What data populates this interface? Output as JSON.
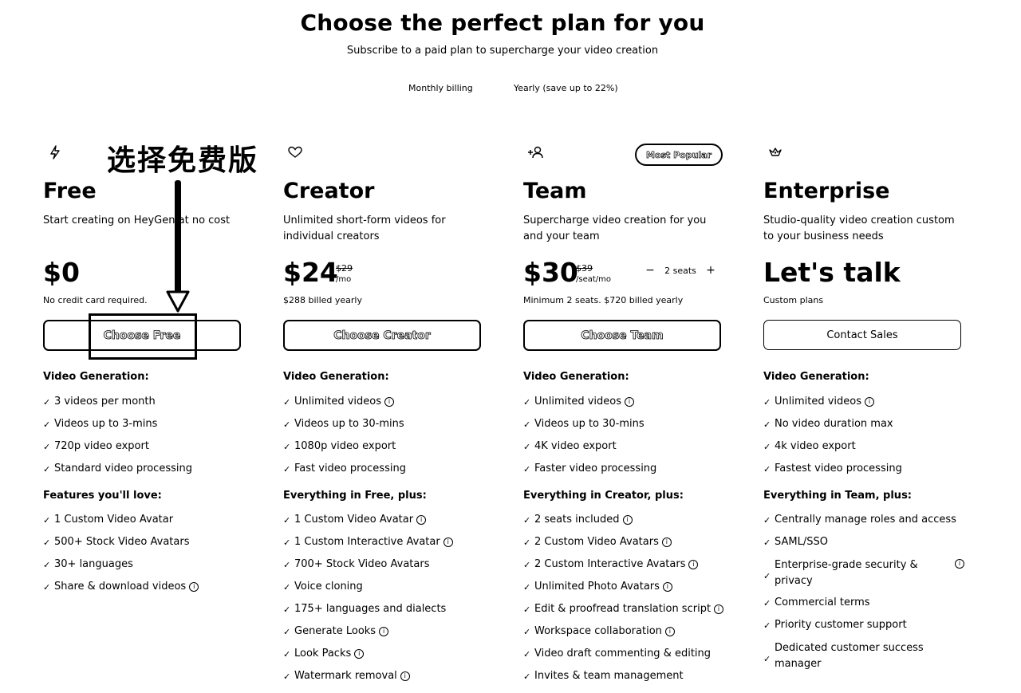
{
  "header": {
    "title": "Choose the perfect plan for you",
    "subtitle": "Subscribe to a paid plan to supercharge your video creation"
  },
  "billing": {
    "monthly": "Monthly billing",
    "yearly": "Yearly (save up to 22%)"
  },
  "annotation": {
    "text": "选择免费版"
  },
  "plans": [
    {
      "icon": "lightning-icon",
      "name": "Free",
      "description": "Start creating on HeyGen at no cost",
      "price": "$0",
      "note": "No credit card required.",
      "cta": "Choose Free",
      "sections": [
        {
          "title": "Video Generation:",
          "items": [
            "3 videos per month",
            "Videos up to 3-mins",
            "720p video export",
            "Standard video processing"
          ]
        },
        {
          "title": "Features you'll love:",
          "items": [
            "1 Custom Video Avatar",
            "500+ Stock Video Avatars",
            "30+ languages",
            "Share & download videos"
          ]
        }
      ]
    },
    {
      "icon": "heart-icon",
      "name": "Creator",
      "description": "Unlimited short-form videos for individual creators",
      "price": "$24",
      "strike": "$29",
      "per": "/mo",
      "note": "$288 billed yearly",
      "cta": "Choose Creator",
      "sections": [
        {
          "title": "Video Generation:",
          "items": [
            "Unlimited videos",
            "Videos up to 30-mins",
            "1080p video export",
            "Fast video processing"
          ]
        },
        {
          "title": "Everything in Free, plus:",
          "items": [
            "1 Custom Video Avatar",
            "1 Custom Interactive Avatar",
            "700+ Stock Video Avatars",
            "Voice cloning",
            "175+ languages and dialects",
            "Generate Looks",
            "Look Packs",
            "Watermark removal"
          ]
        }
      ]
    },
    {
      "icon": "add-user-icon",
      "name": "Team",
      "badge": "Most Popular",
      "description": "Supercharge video creation for you and your team",
      "price": "$30",
      "strike": "$39",
      "per": "/seat/mo",
      "seats": {
        "minus": "−",
        "label": "2 seats",
        "plus": "+"
      },
      "note": "Minimum 2 seats. $720 billed yearly",
      "cta": "Choose Team",
      "sections": [
        {
          "title": "Video Generation:",
          "items": [
            "Unlimited videos",
            "Videos up to 30-mins",
            "4K video export",
            "Faster video processing"
          ]
        },
        {
          "title": "Everything in Creator, plus:",
          "items": [
            "2 seats included",
            "2 Custom Video Avatars",
            "2 Custom Interactive Avatars",
            "Unlimited Photo Avatars",
            "Edit & proofread translation script",
            "Workspace collaboration",
            "Video draft commenting & editing",
            "Invites & team management"
          ]
        }
      ]
    },
    {
      "icon": "crown-icon",
      "name": "Enterprise",
      "description": "Studio-quality video creation custom to your business needs",
      "price": "Let's talk",
      "note": "Custom plans",
      "cta": "Contact Sales",
      "sections": [
        {
          "title": "Video Generation:",
          "items": [
            "Unlimited videos",
            "No video duration max",
            "4k video export",
            "Fastest video processing"
          ]
        },
        {
          "title": "Everything in Team, plus:",
          "items": [
            "Centrally manage roles and access",
            "SAML/SSO",
            "Enterprise-grade security & privacy",
            "Commercial terms",
            "Priority customer support",
            "Dedicated customer success manager"
          ]
        }
      ]
    }
  ]
}
